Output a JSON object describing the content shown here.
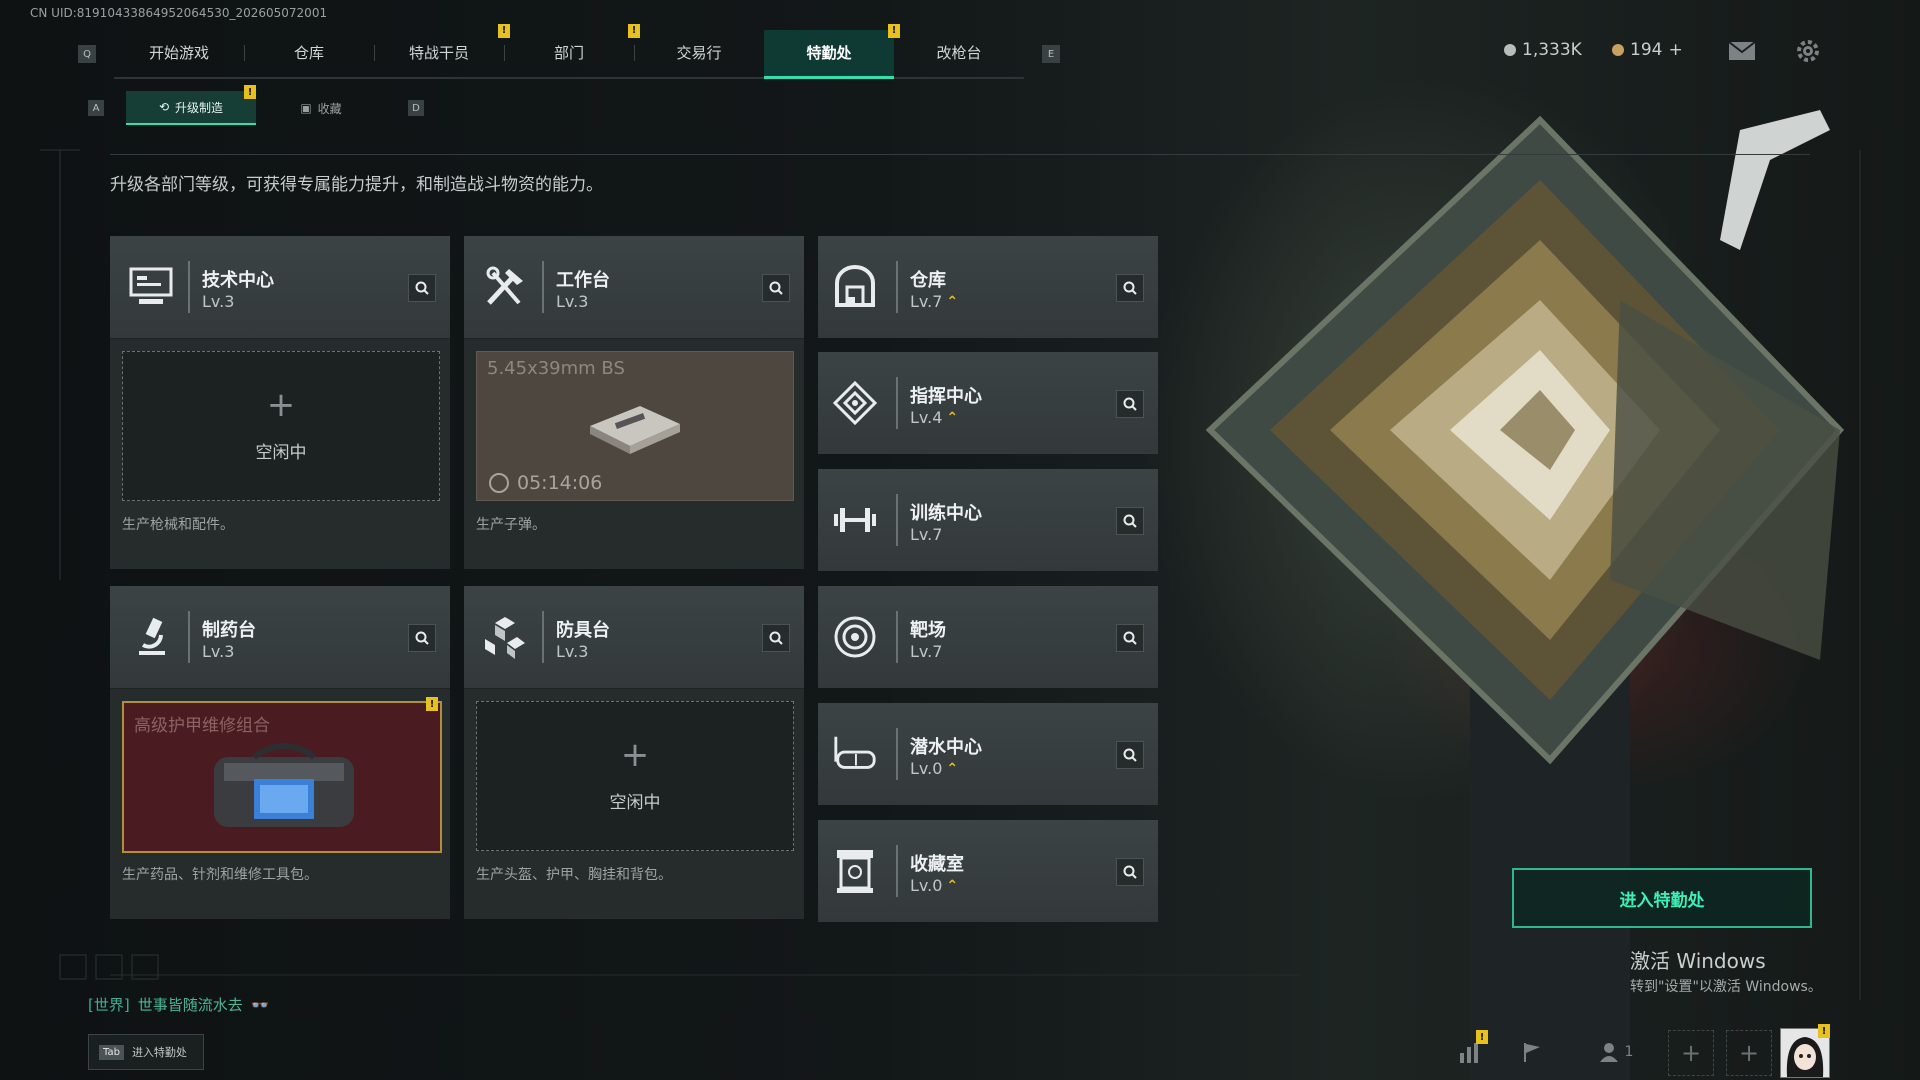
{
  "uid": "CN UID:81910433864952064530_202605072001",
  "nav": {
    "key_left": "Q",
    "key_right": "E",
    "tabs": [
      {
        "label": "开始游戏",
        "badge": ""
      },
      {
        "label": "仓库",
        "badge": ""
      },
      {
        "label": "特战干员",
        "badge": "!"
      },
      {
        "label": "部门",
        "badge": "!"
      },
      {
        "label": "交易行",
        "badge": ""
      },
      {
        "label": "特勤处",
        "badge": "!",
        "active": true
      },
      {
        "label": "改枪台",
        "badge": ""
      }
    ]
  },
  "currency": {
    "silver": "1,333K",
    "gold": "194",
    "gold_plus": "+"
  },
  "subnav": {
    "key_left": "A",
    "key_right": "D",
    "tabs": [
      {
        "label": "升级制造",
        "badge": "!",
        "active": true
      },
      {
        "label": "收藏",
        "badge": ""
      }
    ]
  },
  "description": "升级各部门等级，可获得专属能力提升，和制造战斗物资的能力。",
  "cards": {
    "tech": {
      "name": "技术中心",
      "level": "Lv.3",
      "slot_state": "空闲中",
      "plus": "+",
      "desc": "生产枪械和配件。",
      "icon": "monitor-icon"
    },
    "workbench": {
      "name": "工作台",
      "level": "Lv.3",
      "product": "5.45x39mm BS",
      "timer": "05:14:06",
      "desc": "生产子弹。",
      "icon": "tools-icon"
    },
    "pharmacy": {
      "name": "制药台",
      "level": "Lv.3",
      "product": "高级护甲维修组合",
      "badge": "!",
      "desc": "生产药品、针剂和维修工具包。",
      "icon": "microscope-icon"
    },
    "armor": {
      "name": "防具台",
      "level": "Lv.3",
      "slot_state": "空闲中",
      "plus": "+",
      "desc": "生产头盔、护甲、胸挂和背包。",
      "icon": "cubes-icon"
    }
  },
  "facilities": [
    {
      "name": "仓库",
      "level": "Lv.7",
      "upgradable": true,
      "icon": "warehouse-icon"
    },
    {
      "name": "指挥中心",
      "level": "Lv.4",
      "upgradable": true,
      "icon": "command-icon"
    },
    {
      "name": "训练中心",
      "level": "Lv.7",
      "upgradable": false,
      "icon": "dumbbell-icon"
    },
    {
      "name": "靶场",
      "level": "Lv.7",
      "upgradable": false,
      "icon": "target-icon"
    },
    {
      "name": "潜水中心",
      "level": "Lv.0",
      "upgradable": true,
      "icon": "diving-mask-icon"
    },
    {
      "name": "收藏室",
      "level": "Lv.0",
      "upgradable": true,
      "icon": "collection-icon"
    }
  ],
  "up_glyph": "⌃",
  "enter_button": "进入特勤处",
  "windows": {
    "title": "激活 Windows",
    "subtitle": "转到\"设置\"以激活 Windows。"
  },
  "chat": {
    "channel": "[世界]",
    "message": "世事皆随流水去",
    "emote": "👓"
  },
  "tab_hint": {
    "key": "Tab",
    "label": "进入特勤处"
  },
  "friends_count": "1",
  "bottom_badge": "!",
  "colors": {
    "accent": "#2fe0b0",
    "badge": "#e8c020",
    "enter_text": "#3cf0b8"
  }
}
